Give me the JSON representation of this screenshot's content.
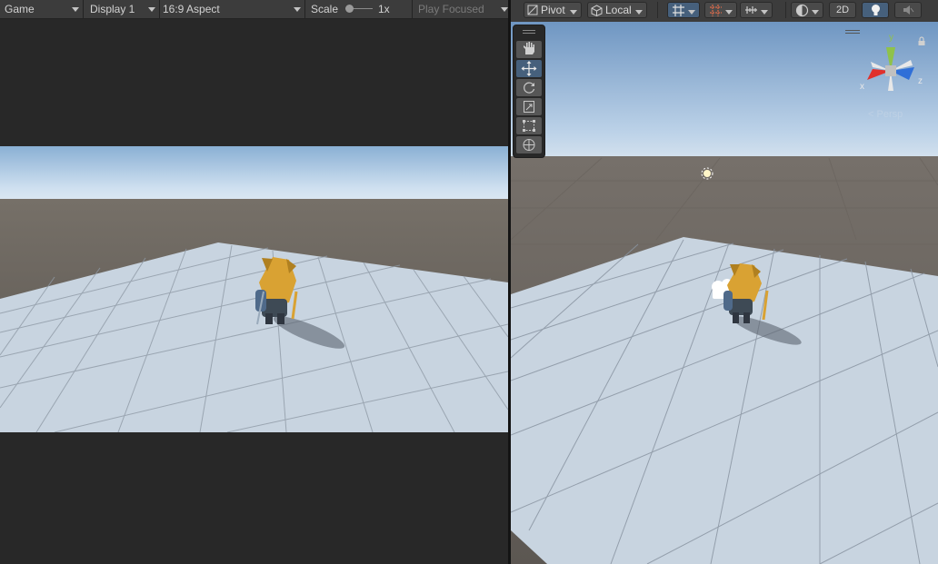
{
  "game_toolbar": {
    "view": "Game",
    "display": "Display 1",
    "aspect": "16:9 Aspect",
    "scale_label": "Scale",
    "scale_value": "1x",
    "play_mode": "Play Focused"
  },
  "scene_toolbar": {
    "pivot": "Pivot",
    "space": "Local",
    "mode_2d": "2D"
  },
  "gizmo": {
    "x_label": "x",
    "y_label": "y",
    "z_label": "z",
    "projection": "Persp"
  },
  "colors": {
    "sky_top": "#8ab0d4",
    "horizon": "#cfe0f0",
    "ground": "#5f5a55",
    "floor": "#c7d3df",
    "selected_tool": "#46607c"
  }
}
